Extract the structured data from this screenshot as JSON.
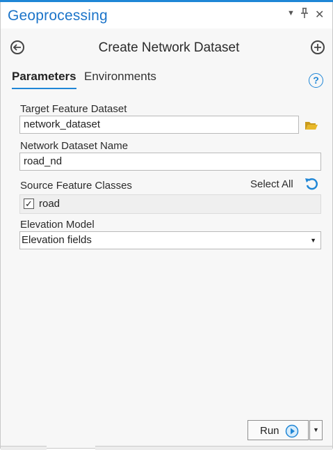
{
  "window": {
    "title": "Geoprocessing",
    "controls": [
      "dropdown-icon",
      "pin-icon",
      "close-icon"
    ],
    "accent_color": "#1f86d6"
  },
  "tool": {
    "title": "Create Network Dataset",
    "back_icon": "back-arrow-icon",
    "add_icon": "add-icon"
  },
  "tabs": [
    {
      "label": "Parameters",
      "active": true
    },
    {
      "label": "Environments",
      "active": false
    }
  ],
  "help_icon": "?",
  "params": {
    "target_feature_dataset": {
      "label": "Target Feature Dataset",
      "value": "network_dataset"
    },
    "network_dataset_name": {
      "label": "Network Dataset Name",
      "value": "road_nd"
    },
    "source_feature_classes": {
      "label": "Source Feature Classes",
      "select_all": "Select All",
      "items": [
        {
          "label": "road",
          "checked": true
        }
      ]
    },
    "elevation_model": {
      "label": "Elevation Model",
      "value": "Elevation fields"
    }
  },
  "run": {
    "label": "Run"
  }
}
